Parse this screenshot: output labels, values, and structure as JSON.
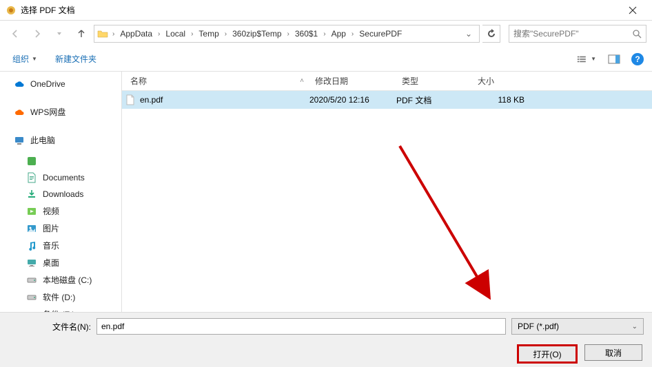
{
  "title": "选择 PDF 文档",
  "breadcrumb": [
    "AppData",
    "Local",
    "Temp",
    "360zip$Temp",
    "360$1",
    "App",
    "SecurePDF"
  ],
  "search_placeholder": "搜索\"SecurePDF\"",
  "toolbar": {
    "organize": "组织",
    "new_folder": "新建文件夹"
  },
  "columns": {
    "name": "名称",
    "date": "修改日期",
    "type": "类型",
    "size": "大小"
  },
  "files": [
    {
      "name": "en.pdf",
      "date": "2020/5/20 12:16",
      "type": "PDF 文档",
      "size": "118 KB"
    }
  ],
  "sidebar": {
    "items": [
      {
        "label": "OneDrive",
        "icon": "cloud",
        "color": "#0078d4"
      },
      {
        "label": "WPS网盘",
        "icon": "cloud",
        "color": "#ff6a00"
      },
      {
        "label": "此电脑",
        "icon": "pc",
        "color": "#0078d4"
      },
      {
        "label": "",
        "icon": "green-square",
        "sub": true
      },
      {
        "label": "Documents",
        "icon": "doc",
        "sub": true
      },
      {
        "label": "Downloads",
        "icon": "download",
        "sub": true
      },
      {
        "label": "视频",
        "icon": "video",
        "sub": true
      },
      {
        "label": "图片",
        "icon": "picture",
        "sub": true
      },
      {
        "label": "音乐",
        "icon": "music",
        "sub": true
      },
      {
        "label": "桌面",
        "icon": "desktop",
        "sub": true
      },
      {
        "label": "本地磁盘 (C:)",
        "icon": "drive",
        "sub": true
      },
      {
        "label": "软件 (D:)",
        "icon": "drive",
        "sub": true
      },
      {
        "label": "备份 (E:)",
        "icon": "drive",
        "sub": true
      }
    ]
  },
  "filename_label": "文件名(N):",
  "filename_value": "en.pdf",
  "filter": "PDF (*.pdf)",
  "buttons": {
    "open": "打开(O)",
    "cancel": "取消"
  }
}
